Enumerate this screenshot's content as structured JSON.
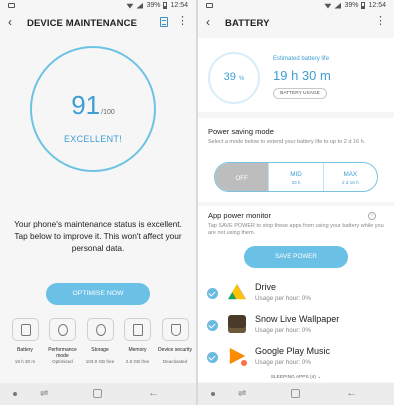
{
  "status": {
    "battery": "39%",
    "time": "12:54"
  },
  "left": {
    "title": "DEVICE MAINTENANCE",
    "score": "91",
    "score_max": "/100",
    "score_label": "EXCELLENT!",
    "description": "Your phone's maintenance status is excellent. Tap below to improve it. This won't affect your personal data.",
    "optimise_label": "OPTIMISE NOW",
    "tiles": [
      {
        "label": "Battery",
        "value": "19 h 30 m",
        "icon": "battery-icon"
      },
      {
        "label": "Performance mode",
        "value": "Optimised",
        "icon": "performance-icon"
      },
      {
        "label": "Storage",
        "value": "103.9 GB free",
        "icon": "storage-icon"
      },
      {
        "label": "Memory",
        "value": "2.6 GB free",
        "icon": "memory-icon"
      },
      {
        "label": "Device security",
        "value": "Deactivated",
        "icon": "security-icon"
      }
    ]
  },
  "right": {
    "title": "BATTERY",
    "percent": "39",
    "percent_unit": "%",
    "est_label": "Estimated battery life",
    "est_value": "19 h 30 m",
    "usage_label": "BATTERY USAGE",
    "power_saving_title": "Power saving mode",
    "power_saving_desc": "Select a mode below to extend your battery life to up to 2 d 16 h.",
    "modes": [
      {
        "label": "OFF",
        "sub": ""
      },
      {
        "label": "MID",
        "sub": "33 h"
      },
      {
        "label": "MAX",
        "sub": "2 d 16 h"
      }
    ],
    "monitor_title": "App power monitor",
    "monitor_desc": "Tap SAVE POWER to stop these apps from using your battery while you are not using them.",
    "save_label": "SAVE POWER",
    "apps": [
      {
        "name": "Drive",
        "usage": "Usage per hour: 0%"
      },
      {
        "name": "Snow Live Wallpaper",
        "usage": "Usage per hour: 0%"
      },
      {
        "name": "Google Play Music",
        "usage": "Usage per hour: 0%"
      }
    ],
    "sleeping_label": "SLEEPING APPS (4) ⌄"
  }
}
